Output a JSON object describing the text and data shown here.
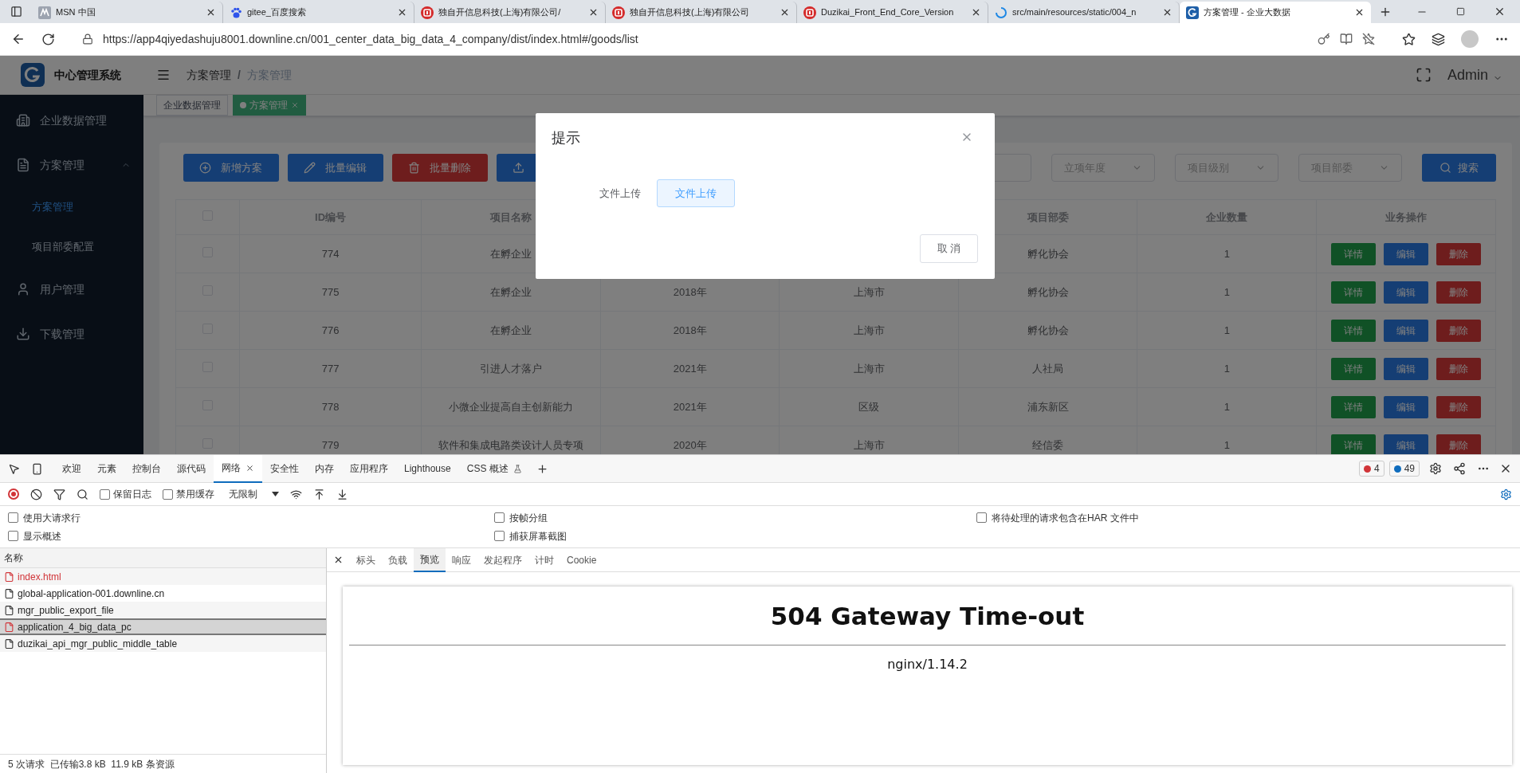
{
  "browser": {
    "tabs": [
      {
        "title": "MSN 中国",
        "kind": "msn",
        "selected": false
      },
      {
        "title": "gitee_百度搜索",
        "kind": "paw",
        "selected": false
      },
      {
        "title": "独自开信息科技(上海)有限公司/",
        "kind": "brand",
        "selected": false
      },
      {
        "title": "独自开信息科技(上海)有限公司",
        "kind": "brand",
        "selected": false
      },
      {
        "title": "Duzikai_Front_End_Core_Version",
        "kind": "brand",
        "selected": false
      },
      {
        "title": "src/main/resources/static/004_n",
        "kind": "loading",
        "selected": false
      },
      {
        "title": "方案管理 - 企业大数据",
        "kind": "app",
        "selected": true
      }
    ],
    "url": "https://app4qiyedashuju8001.downline.cn/001_center_data_big_data_4_company/dist/index.html#/goods/list"
  },
  "app": {
    "title": "中心管理系统",
    "breadcrumb": {
      "items": [
        "方案管理",
        "方案管理"
      ],
      "separator": "/"
    },
    "user": "Admin",
    "menu": [
      {
        "label": "企业数据管理",
        "kind": "building"
      },
      {
        "label": "方案管理",
        "kind": "document",
        "expanded": true,
        "children": [
          {
            "label": "方案管理",
            "selected": true
          },
          {
            "label": "项目部委配置",
            "selected": false
          }
        ]
      },
      {
        "label": "用户管理",
        "kind": "user"
      },
      {
        "label": "下载管理",
        "kind": "download"
      }
    ],
    "tags": [
      {
        "label": "企业数据管理",
        "selected": false
      },
      {
        "label": "方案管理",
        "selected": true
      }
    ],
    "actions": [
      {
        "label": "新增方案",
        "kind": "add"
      },
      {
        "label": "批量编辑",
        "kind": "edit"
      },
      {
        "label": "批量删除",
        "kind": "delete"
      },
      {
        "kind": "import"
      }
    ],
    "filters": [
      {
        "placeholder": "立项年度"
      },
      {
        "placeholder": "项目级别"
      },
      {
        "placeholder": "项目部委"
      }
    ],
    "search_button": "搜索",
    "table": {
      "all_checked": false,
      "columns": [
        "ID编号",
        "项目名称",
        null,
        null,
        "项目部委",
        "企业数量",
        "业务操作"
      ],
      "rows": [
        {
          "checked": false,
          "cells": [
            "774",
            "在孵企业",
            null,
            null,
            "孵化协会",
            "1"
          ],
          "actions": [
            {
              "label": "详情",
              "kind": "detail"
            },
            {
              "label": "编辑",
              "kind": "edit"
            },
            {
              "label": "删除",
              "kind": "delete"
            }
          ]
        },
        {
          "checked": false,
          "cells": [
            "775",
            "在孵企业",
            "2018年",
            "上海市",
            "孵化协会",
            "1"
          ],
          "actions": [
            {
              "label": "详情",
              "kind": "detail"
            },
            {
              "label": "编辑",
              "kind": "edit"
            },
            {
              "label": "删除",
              "kind": "delete"
            }
          ]
        },
        {
          "checked": false,
          "cells": [
            "776",
            "在孵企业",
            "2018年",
            "上海市",
            "孵化协会",
            "1"
          ],
          "actions": [
            {
              "label": "详情",
              "kind": "detail"
            },
            {
              "label": "编辑",
              "kind": "edit"
            },
            {
              "label": "删除",
              "kind": "delete"
            }
          ]
        },
        {
          "checked": false,
          "cells": [
            "777",
            "引进人才落户",
            "2021年",
            "上海市",
            "人社局",
            "1"
          ],
          "actions": [
            {
              "label": "详情",
              "kind": "detail"
            },
            {
              "label": "编辑",
              "kind": "edit"
            },
            {
              "label": "删除",
              "kind": "delete"
            }
          ]
        },
        {
          "checked": false,
          "cells": [
            "778",
            "小微企业提高自主创新能力",
            "2021年",
            "区级",
            "浦东新区",
            "1"
          ],
          "actions": [
            {
              "label": "详情",
              "kind": "detail"
            },
            {
              "label": "编辑",
              "kind": "edit"
            },
            {
              "label": "删除",
              "kind": "delete"
            }
          ]
        },
        {
          "checked": false,
          "cells": [
            "779",
            "软件和集成电路类设计人员专项",
            "2020年",
            "上海市",
            "经信委",
            "1"
          ],
          "actions": [
            {
              "label": "详情",
              "kind": "detail"
            },
            {
              "label": "编辑",
              "kind": "edit"
            },
            {
              "label": "删除",
              "kind": "delete"
            }
          ]
        }
      ]
    }
  },
  "dialog": {
    "title": "提示",
    "field_label": "文件上传",
    "upload_button": "文件上传",
    "cancel_button": "取 消"
  },
  "devtools": {
    "tabs": [
      {
        "label": "欢迎",
        "kind": "plain",
        "selected": false
      },
      {
        "label": "元素",
        "kind": "plain",
        "selected": false
      },
      {
        "label": "控制台",
        "kind": "plain",
        "selected": false
      },
      {
        "label": "源代码",
        "kind": "plain",
        "selected": false
      },
      {
        "label": "网络",
        "kind": "plain",
        "selected": true
      },
      {
        "label": "安全性",
        "kind": "plain",
        "selected": false
      },
      {
        "label": "内存",
        "kind": "plain",
        "selected": false
      },
      {
        "label": "应用程序",
        "kind": "plain",
        "selected": false
      },
      {
        "label": "Lighthouse",
        "kind": "plain",
        "selected": false
      },
      {
        "label": "CSS 概述",
        "kind": "experimental",
        "selected": false
      }
    ],
    "errors": "4",
    "messages": "49",
    "recording": true,
    "preserve_log": {
      "label": "保留日志",
      "checked": false
    },
    "disable_cache": {
      "label": "禁用缓存",
      "checked": false
    },
    "throttling": "无限制",
    "options": [
      {
        "label": "使用大请求行",
        "checked": false
      },
      {
        "label": "按帧分组",
        "checked": false
      },
      {
        "label": "将待处理的请求包含在HAR 文件中",
        "checked": false
      },
      {
        "label": "显示概述",
        "checked": false
      },
      {
        "label": "捕获屏幕截图",
        "checked": false
      }
    ],
    "requests_header": "名称",
    "requests": [
      {
        "name": "index.html",
        "failed": true,
        "selected": false
      },
      {
        "name": "global-application-001.downline.cn",
        "failed": false,
        "selected": false
      },
      {
        "name": "mgr_public_export_file",
        "failed": false,
        "selected": false
      },
      {
        "name": "application_4_big_data_pc",
        "failed": true,
        "selected": true
      },
      {
        "name": "duzikai_api_mgr_public_middle_table",
        "failed": false,
        "selected": false
      }
    ],
    "summary": "5 次请求  已传输3.8 kB  11.9 kB 条资源",
    "detail_tabs": [
      {
        "label": "标头",
        "selected": false
      },
      {
        "label": "负载",
        "selected": false
      },
      {
        "label": "预览",
        "selected": true
      },
      {
        "label": "响应",
        "selected": false
      },
      {
        "label": "发起程序",
        "selected": false
      },
      {
        "label": "计时",
        "selected": false
      },
      {
        "label": "Cookie",
        "selected": false
      }
    ],
    "preview": {
      "heading": "504 Gateway Time-out",
      "server": "nginx/1.14.2"
    }
  }
}
